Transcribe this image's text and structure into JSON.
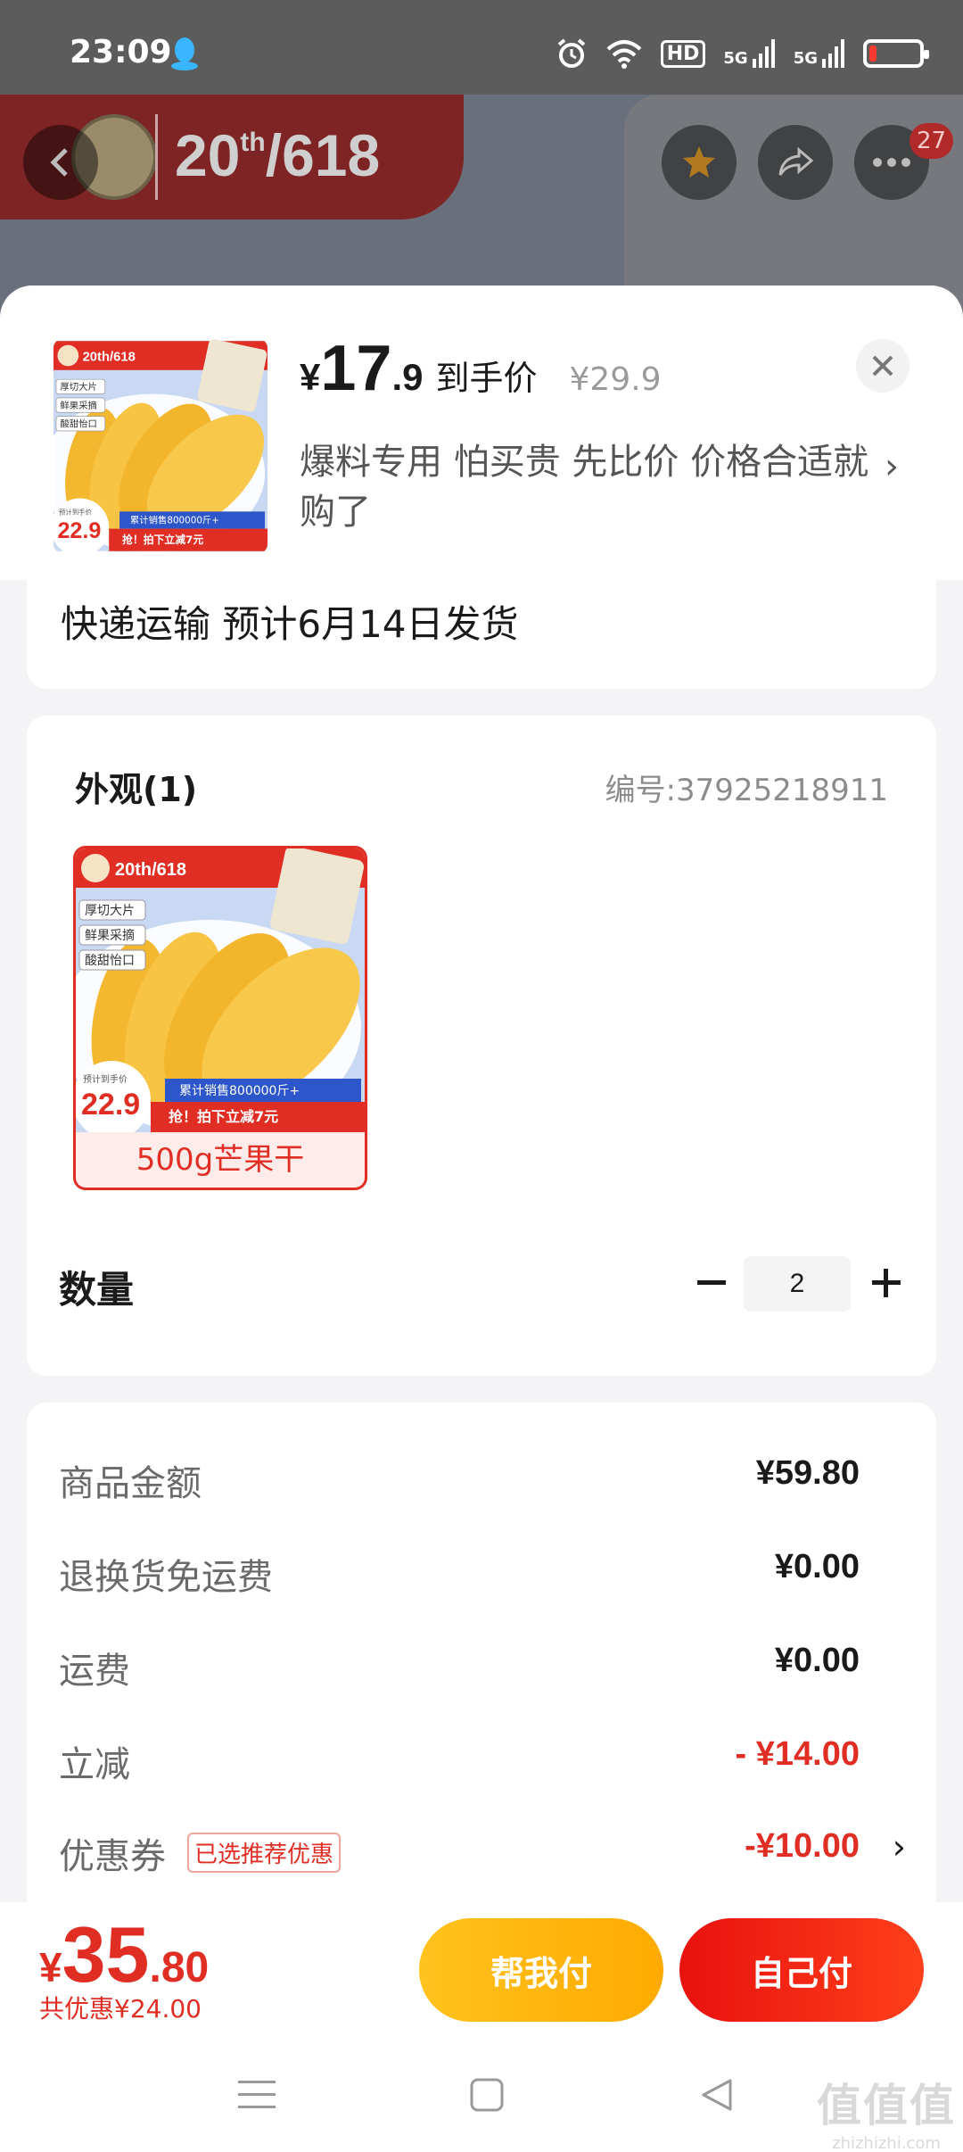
{
  "status_bar": {
    "time": "23:09",
    "hd_label": "HD",
    "net1": "5G",
    "net2": "5G",
    "battery_level": 0.15,
    "icons": [
      "qq-icon",
      "alarm-icon",
      "wifi-icon",
      "hd-icon",
      "signal-icon",
      "signal-icon",
      "battery-icon"
    ]
  },
  "banner": {
    "sale_number": "20",
    "sale_sup": "th",
    "sale_event": "/618",
    "notification_count": "27"
  },
  "product": {
    "price_currency": "¥",
    "price_int": "17",
    "price_dec": ".9",
    "price_tag": "到手价",
    "original_price": "¥29.9",
    "promo": "爆料专用 怕买贵 先比价 价格合适就购了"
  },
  "product_image": {
    "tags": [
      "厚切大片",
      "鲜果采摘",
      "酸甜怡口"
    ],
    "event": "20th/618",
    "est_label": "预计到手价",
    "est_price": "22.9",
    "sold": "累计销售800000斤+",
    "deal": "抢！拍下立减7元"
  },
  "shipping": {
    "text": "快递运输 预计6月14日发货"
  },
  "options": {
    "title": "外观(1)",
    "code": "编号:37925218911",
    "items": [
      {
        "label": "500g芒果干",
        "selected": true
      }
    ]
  },
  "quantity": {
    "label": "数量",
    "value": "2"
  },
  "fees": {
    "rows": [
      {
        "label": "商品金额",
        "value": "¥59.80"
      },
      {
        "label": "退换货免运费",
        "value": "¥0.00"
      },
      {
        "label": "运费",
        "value": "¥0.00"
      },
      {
        "label": "立减",
        "value": "- ¥14.00"
      },
      {
        "label": "优惠券",
        "tag": "已选推荐优惠",
        "value": "-¥10.00"
      }
    ]
  },
  "footer": {
    "total_currency": "¥",
    "total_int": "35",
    "total_dec": ".80",
    "savings": "共优惠¥24.00",
    "btn_help": "帮我付",
    "btn_self": "自己付"
  },
  "watermark": {
    "main": "值值值",
    "sub": "zhizhizhi.com"
  },
  "colors": {
    "accent_red": "#e02e24",
    "accent_yellow": "#ffb300",
    "dim_overlay": "#5c5c5c"
  }
}
